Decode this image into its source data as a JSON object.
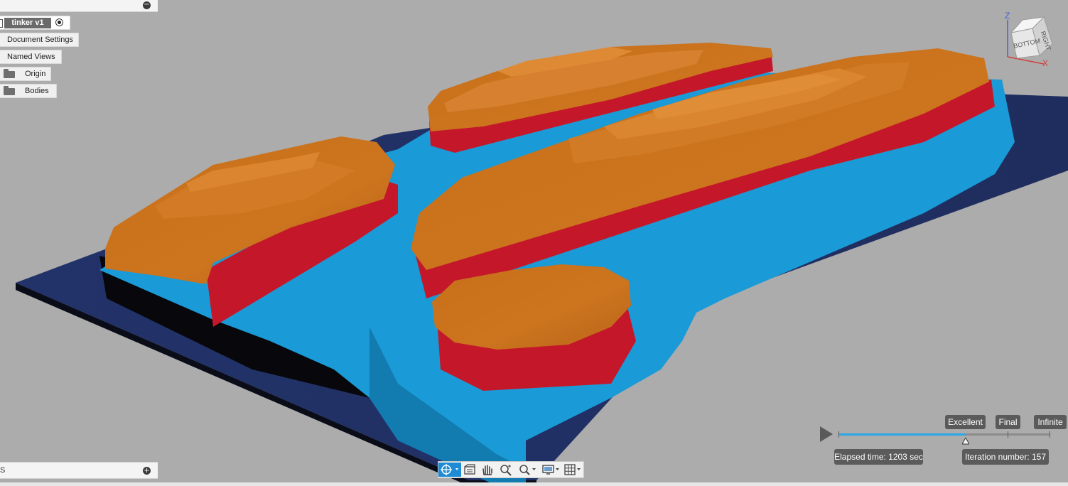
{
  "browser": {
    "root_label": "tinker v1",
    "items": [
      {
        "label": "Document Settings"
      },
      {
        "label": "Named Views"
      },
      {
        "label": "Origin"
      },
      {
        "label": "Bodies"
      }
    ]
  },
  "comments": {
    "label": "S"
  },
  "viewcube": {
    "faces": [
      "BOTTOM",
      "RIGHT"
    ],
    "axes": [
      "Z",
      "X"
    ]
  },
  "render": {
    "quality_levels": [
      "Excellent",
      "Final",
      "Infinite"
    ],
    "elapsed": "Elapsed time: 1203 sec",
    "iteration": "Iteration number: 157",
    "progress_fraction": 0.6
  },
  "toolbar": {
    "tools": [
      "orbit-icon",
      "look-at-icon",
      "pan-icon",
      "zoom-icon",
      "fit-zoom-icon",
      "display-settings-icon",
      "grid-settings-icon"
    ]
  },
  "colors": {
    "background": "#acacac",
    "base_plate": "#1f2f61",
    "water_layer": "#1a9ad6",
    "red_layer": "#c4182a",
    "orange_top": "#c8701c",
    "accent": "#1d8bd6"
  }
}
